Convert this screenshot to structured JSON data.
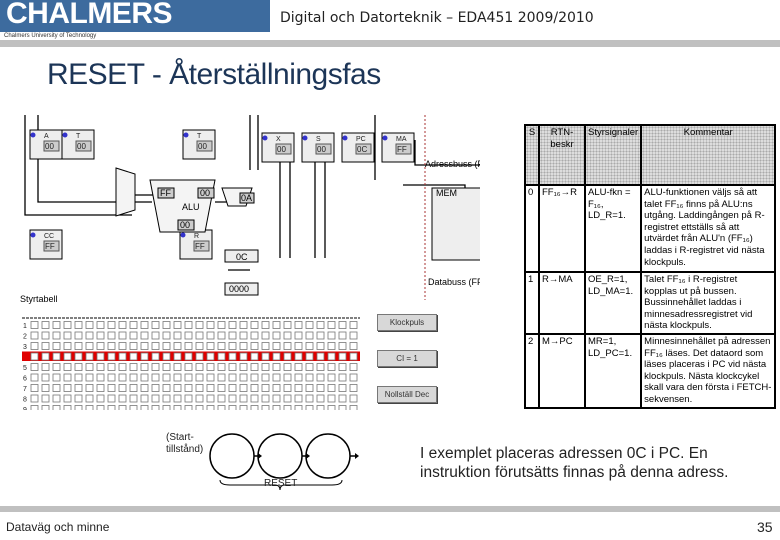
{
  "header": {
    "logo": "CHALMERS",
    "logo_sub": "Chalmers University of Technology",
    "course": "Digital och Datorteknik – EDA451 2009/2010"
  },
  "title": "RESET - Återställningsfas",
  "simulator": {
    "registers": [
      {
        "name": "A",
        "value": "00"
      },
      {
        "name": "T",
        "value": "00"
      },
      {
        "name": "T",
        "value": "00"
      },
      {
        "name": "X",
        "value": "00"
      },
      {
        "name": "S",
        "value": "00"
      },
      {
        "name": "PC",
        "value": "0C"
      },
      {
        "name": "MA",
        "value": "FF"
      },
      {
        "name": "R",
        "value": "FF"
      },
      {
        "name": "CC",
        "value": "FF"
      }
    ],
    "alu_values": [
      "FF",
      "00",
      "00"
    ],
    "mux_value": "0A",
    "decoder_value": "0000",
    "memory_value": "0C",
    "labels": {
      "address_bus": "Adressbuss (FF)",
      "data_bus": "Databuss (FF)",
      "styrtabell": "Styrtabell",
      "alu": "ALU"
    },
    "highlight_row": 4,
    "row_count": 9,
    "buttons": [
      "Klockpuls",
      "CI = 1",
      "Nollställ Dec"
    ],
    "accent": "#e00000"
  },
  "table": {
    "headers": [
      "S",
      "RTN-beskr",
      "Styrsignaler",
      "Kommentar"
    ],
    "rows": [
      {
        "s": "0",
        "rtn": "FF₁₆→R",
        "signals": "ALU-fkn = F₁₆, LD_R=1.",
        "comment": "ALU-funktionen väljs så att talet FF₁₆ finns på ALU:ns utgång. Laddingången på R-registret ettställs så att utvärdet från ALU'n (FF₁₆) laddas i R-registret vid nästa klockpuls."
      },
      {
        "s": "1",
        "rtn": "R→MA",
        "signals": "OE_R=1, LD_MA=1.",
        "comment": "Talet FF₁₆ i R-registret kopplas ut på bussen. Bussinnehållet laddas i minnesadressregistret vid nästa klockpuls."
      },
      {
        "s": "2",
        "rtn": "M→PC",
        "signals": "MR=1, LD_PC=1.",
        "comment": "Minnesinnehållet på adressen FF₁₆ läses. Det dataord som läses placeras i PC vid nästa klockpuls. Nästa klockcykel skall vara den första i FETCH-sekvensen."
      }
    ]
  },
  "state_diagram": {
    "start_label": "(Start-tillstånd)",
    "group_label": "RESET",
    "states": 3
  },
  "description": "I exemplet placeras adressen 0C i PC. En instruktion förutsätts finnas på denna adress.",
  "footer": {
    "left": "Dataväg och minne",
    "page": "35"
  }
}
